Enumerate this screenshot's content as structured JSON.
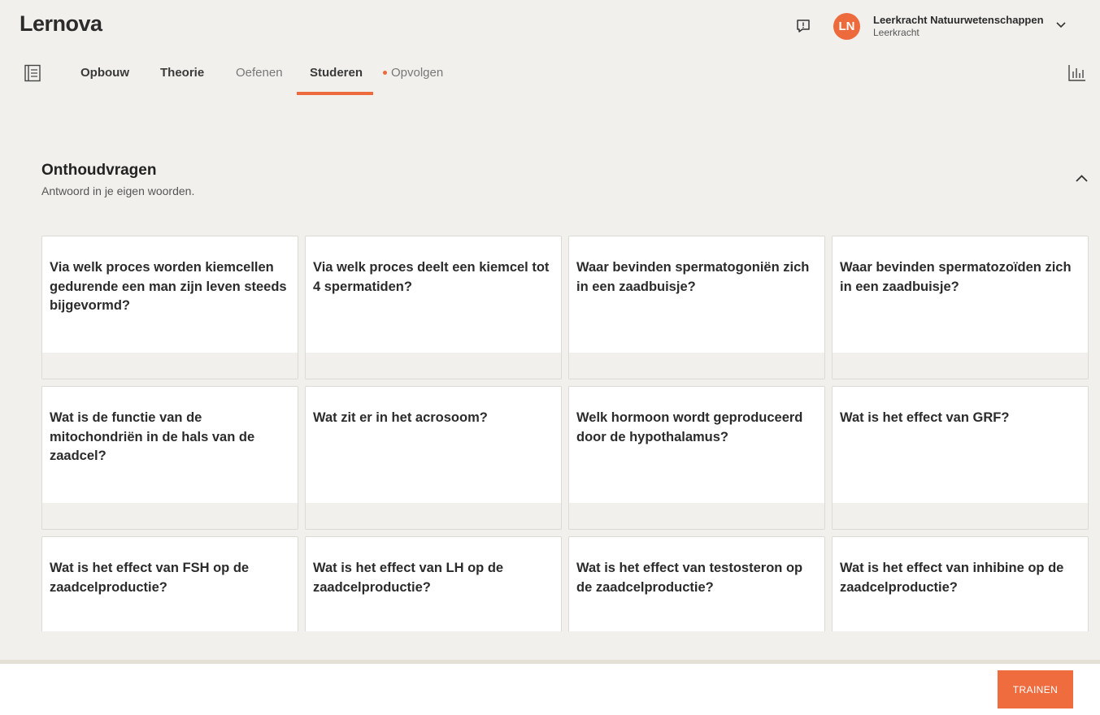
{
  "header": {
    "logo": {
      "text": "Lernova"
    },
    "user": {
      "initials": "LN",
      "name": "Leerkracht Natuurwetenschappen",
      "role": "Leerkracht"
    }
  },
  "nav": {
    "tabs": [
      {
        "label": "Opbouw",
        "state": "bold"
      },
      {
        "label": "Theorie",
        "state": "bold"
      },
      {
        "label": "Oefenen",
        "state": "normal"
      },
      {
        "label": "Studeren",
        "state": "active"
      },
      {
        "label": "Opvolgen",
        "state": "normal",
        "indicator": true
      }
    ]
  },
  "section": {
    "title": "Onthoudvragen",
    "subtitle": "Antwoord in je eigen woorden."
  },
  "cards": [
    "Via welk proces worden kiemcellen gedurende een man zijn leven steeds bijgevormd?",
    "Via welk proces deelt een kiemcel tot 4 spermatiden?",
    "Waar bevinden spermatogoniën zich in een zaadbuisje?",
    "Waar bevinden spermatozoïden zich in een zaadbuisje?",
    "Wat is de functie van de mitochondriën in de hals van de zaadcel?",
    "Wat zit er in het acrosoom?",
    "Welk hormoon wordt geproduceerd door de hypothalamus?",
    "Wat is het effect van GRF?",
    "Wat is het effect van FSH op de zaadcelproductie?",
    "Wat is het effect van LH op de zaadcelproductie?",
    "Wat is het effect van testosteron op de zaadcelproductie?",
    "Wat is het effect van inhibine op de zaadcelproductie?"
  ],
  "footer": {
    "train_label": "TRAINEN"
  },
  "colors": {
    "accent": "#ec6a3b",
    "background": "#f1f0ed",
    "card": "#ffffff"
  },
  "icons": [
    "feedback-icon",
    "chevron-down-icon",
    "book-icon",
    "stats-icon",
    "chevron-up-icon"
  ]
}
